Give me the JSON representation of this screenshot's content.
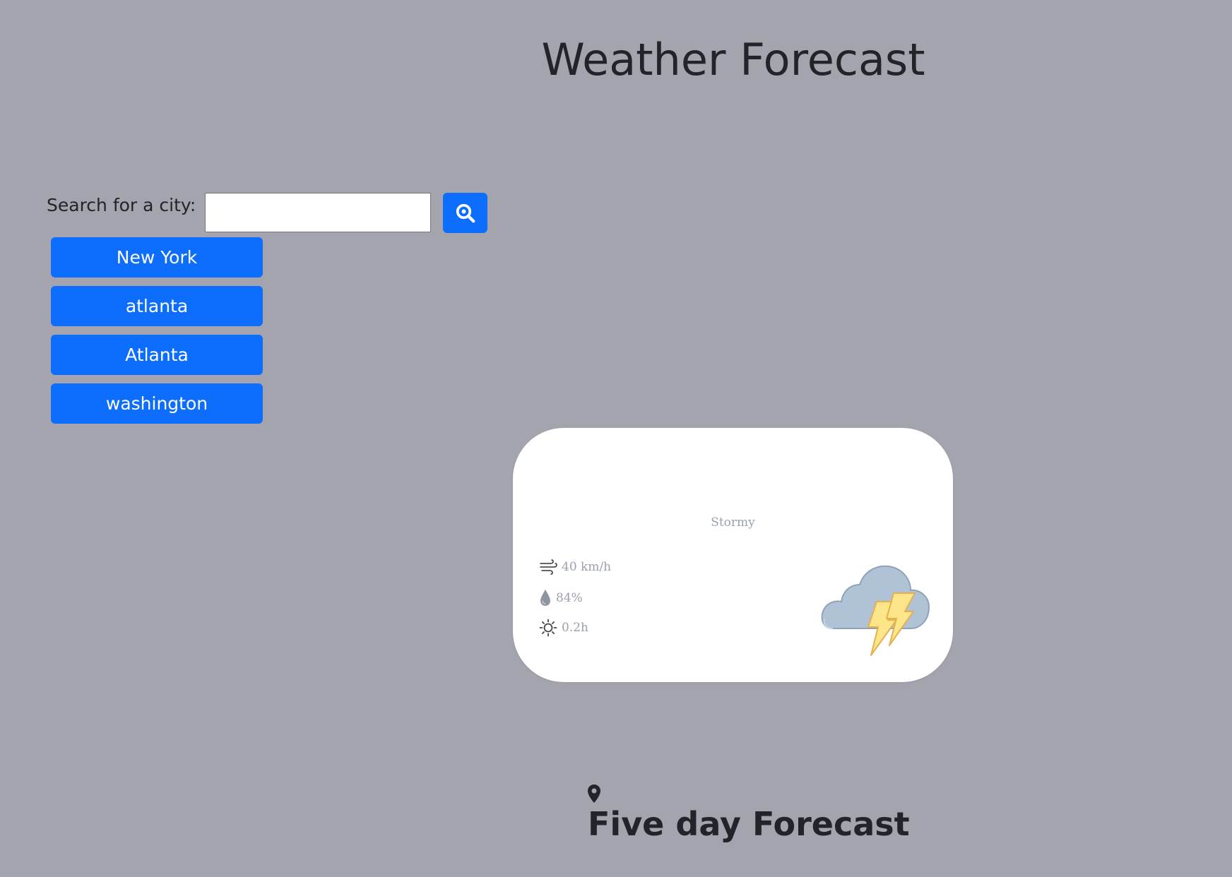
{
  "header": {
    "title": "Weather Forecast"
  },
  "search": {
    "label": "Search for a city:",
    "value": "",
    "placeholder": "",
    "button_icon": "search-icon"
  },
  "history": {
    "items": [
      {
        "label": "New York"
      },
      {
        "label": "atlanta"
      },
      {
        "label": "Atlanta"
      },
      {
        "label": "washington"
      }
    ]
  },
  "current": {
    "condition": "Stormy",
    "wind": "40 km/h",
    "humidity": "84%",
    "sunshine": "0.2h",
    "icons": {
      "wind": "wind-icon",
      "humidity": "raindrop-icon",
      "sunshine": "sun-icon",
      "weather": "thunderstorm-icon"
    }
  },
  "forecast": {
    "title": "Five day Forecast",
    "location_icon": "map-pin-icon"
  },
  "colors": {
    "background": "#a4a4af",
    "button": "#0d6efd",
    "card": "#ffffff",
    "muted_text": "#9aa1ac"
  }
}
